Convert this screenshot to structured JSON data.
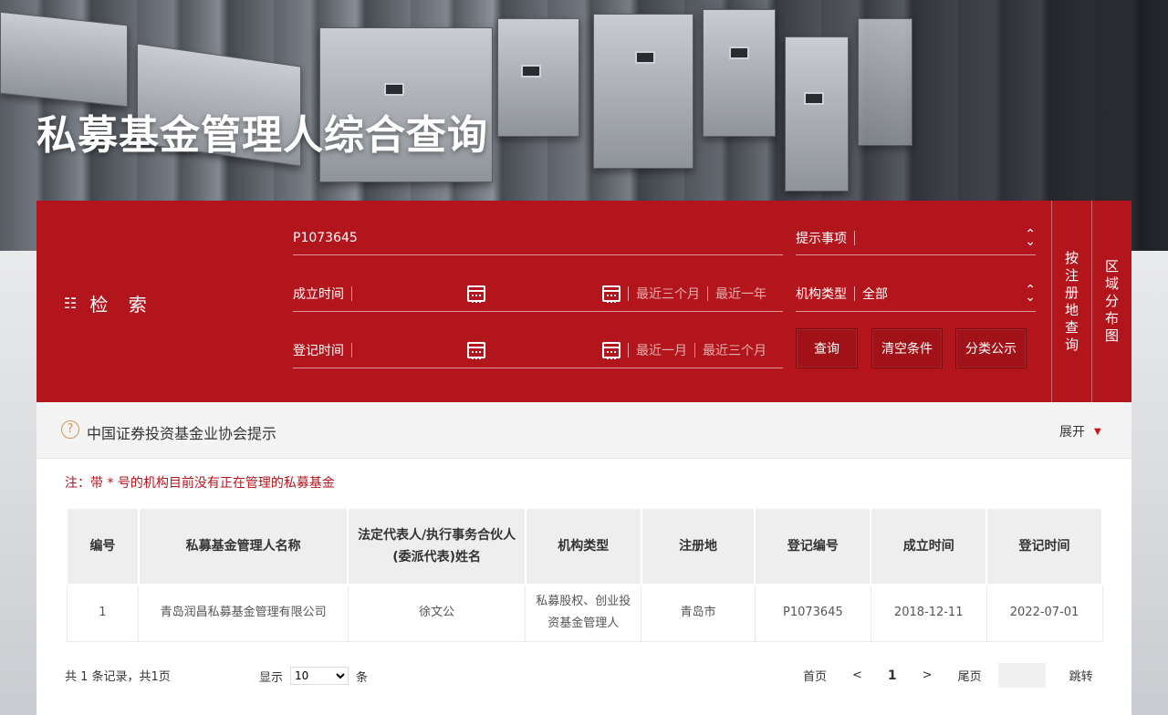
{
  "page": {
    "title": "私募基金管理人综合查询"
  },
  "search": {
    "label": "检 索",
    "keyword_value": "P1073645",
    "hint_label": "提示事项",
    "hint_value": "",
    "established_label": "成立时间",
    "established_quick": [
      "最近三个月",
      "最近一年"
    ],
    "org_type_label": "机构类型",
    "org_type_value": "全部",
    "registered_label": "登记时间",
    "registered_quick": [
      "最近一月",
      "最近三个月"
    ],
    "buttons": {
      "query": "查询",
      "clear": "清空条件",
      "category": "分类公示"
    },
    "side_tabs": {
      "by_region": "按注册地查询",
      "distribution": "区域分布图"
    }
  },
  "notice": {
    "title": "中国证券投资基金业协会提示",
    "expand_label": "展开",
    "note": "注：带 * 号的机构目前没有正在管理的私募基金"
  },
  "table": {
    "headers": [
      "编号",
      "私募基金管理人名称",
      "法定代表人/执行事务合伙人(委派代表)姓名",
      "机构类型",
      "注册地",
      "登记编号",
      "成立时间",
      "登记时间"
    ],
    "rows": [
      [
        "1",
        "青岛润昌私募基金管理有限公司",
        "徐文公",
        "私募股权、创业投资基金管理人",
        "青岛市",
        "P1073645",
        "2018-12-11",
        "2022-07-01"
      ]
    ]
  },
  "pagination": {
    "summary": "共 1 条记录，共1页",
    "show_label": "显示",
    "page_size": "10",
    "unit": "条",
    "first": "首页",
    "prev": "<",
    "current": "1",
    "next": ">",
    "last": "尾页",
    "jump": "跳转"
  }
}
